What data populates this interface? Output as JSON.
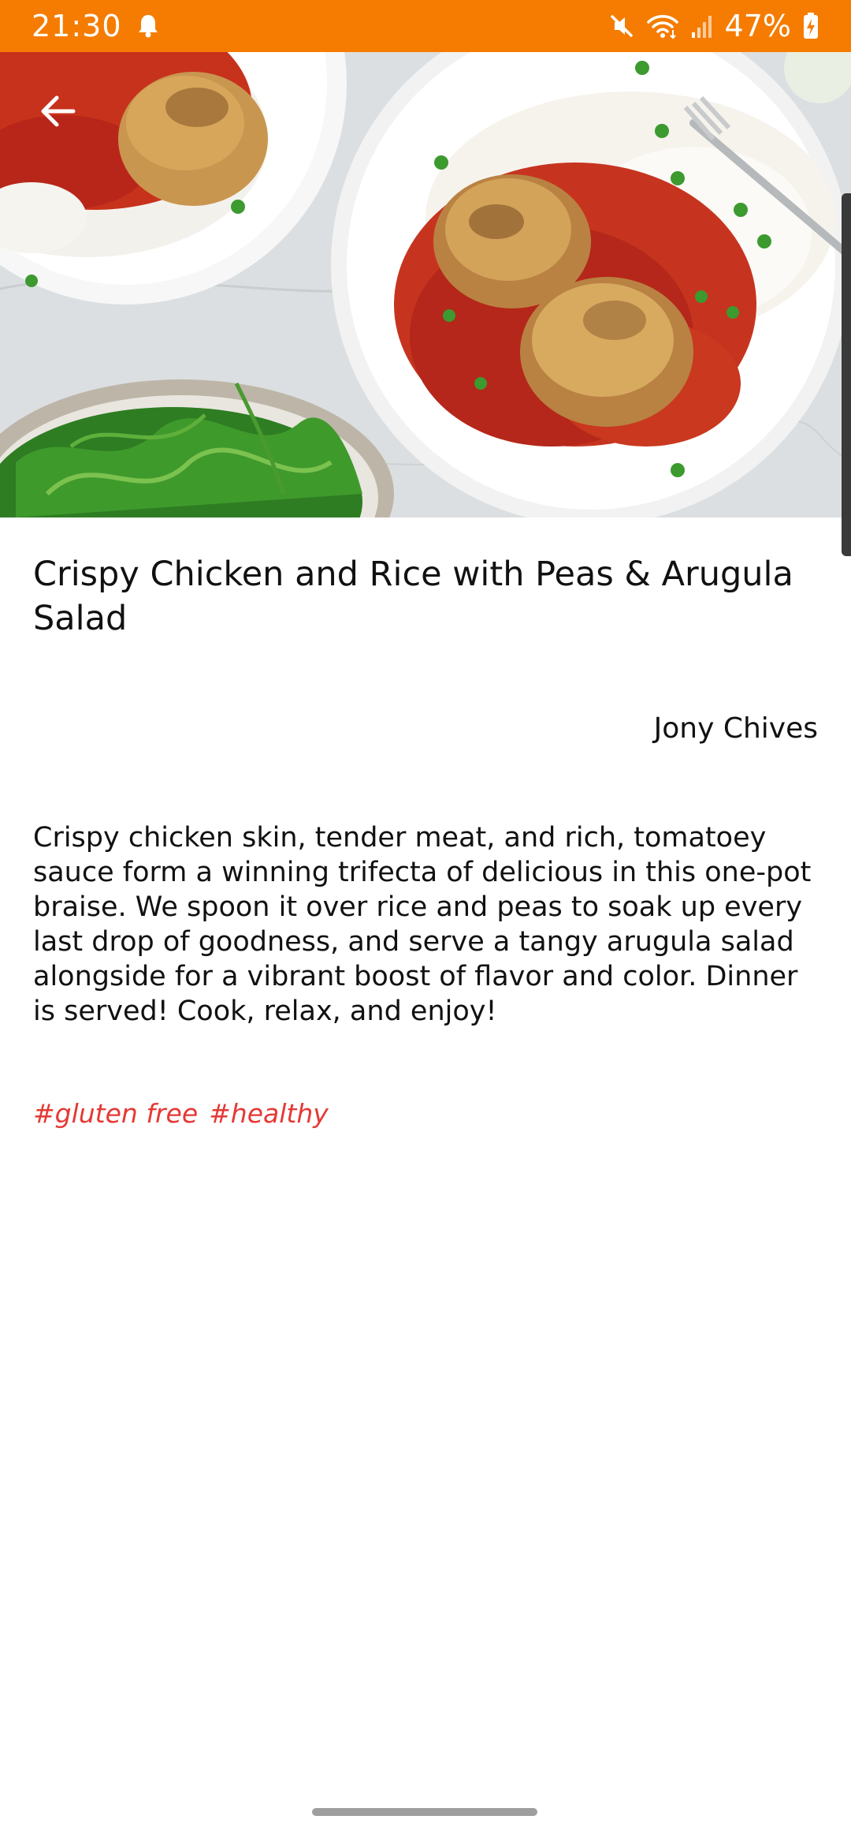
{
  "status_bar": {
    "time": "21:30",
    "battery": "47%",
    "background_color": "#F57C00",
    "icons": [
      "notification-bell-icon",
      "mute-icon",
      "wifi-icon",
      "signal-icon",
      "battery-charging-icon"
    ]
  },
  "hero": {
    "image_subject": "plated chicken, rice, peas and arugula salad",
    "back_icon": "arrow-left-icon"
  },
  "recipe": {
    "title": "Crispy Chicken and Rice  with Peas & Arugula Salad",
    "author": "Jony Chives",
    "description": "Crispy chicken skin, tender meat, and rich, tomatoey sauce form a winning trifecta of delicious in this one-pot braise. We spoon it over rice and peas to soak up every last drop of goodness, and serve a tangy arugula salad alongside for a vibrant boost of flavor and color. Dinner is served! Cook, relax, and enjoy!",
    "tags": [
      "#gluten free",
      "#healthy"
    ],
    "tag_color": "#E53935"
  }
}
